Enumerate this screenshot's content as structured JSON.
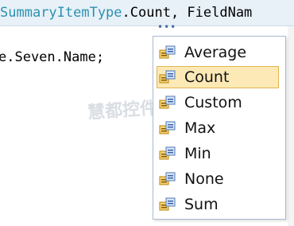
{
  "editor": {
    "line1": {
      "type_name": "SummaryItemType",
      "rest": ".Count, FieldNam"
    },
    "line2": {
      "text": "e.Seven.Name;"
    },
    "smart_tag": "•••"
  },
  "completion_list": {
    "selected_index": 1,
    "items": [
      {
        "label": "Average",
        "icon": "enum-member-icon"
      },
      {
        "label": "Count",
        "icon": "enum-member-icon"
      },
      {
        "label": "Custom",
        "icon": "enum-member-icon"
      },
      {
        "label": "Max",
        "icon": "enum-member-icon"
      },
      {
        "label": "Min",
        "icon": "enum-member-icon"
      },
      {
        "label": "None",
        "icon": "enum-member-icon"
      },
      {
        "label": "Sum",
        "icon": "enum-member-icon"
      }
    ]
  },
  "watermark": {
    "text": "慧都控件网"
  }
}
